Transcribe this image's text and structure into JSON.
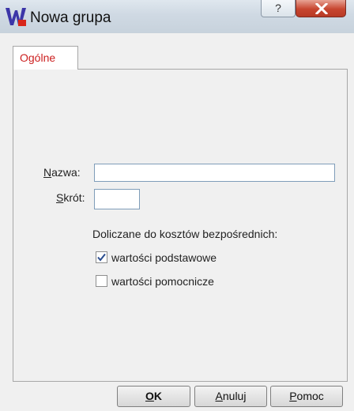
{
  "window": {
    "title": "Nowa grupa",
    "help_glyph": "?",
    "close_icon": "close-icon"
  },
  "tabs": [
    {
      "label": "Ogólne",
      "active": true,
      "color": "#cc2020"
    }
  ],
  "form": {
    "name_label_prefix": "N",
    "name_label_rest": "azwa:",
    "name_value": "",
    "short_label_prefix": "S",
    "short_label_rest": "krót:",
    "short_value": "",
    "costs_label": "Doliczane do kosztów bezpośrednich:",
    "options": [
      {
        "label": "wartości podstawowe",
        "checked": true
      },
      {
        "label": "wartości pomocnicze",
        "checked": false
      }
    ]
  },
  "buttons": {
    "ok_prefix": "O",
    "ok_rest": "K",
    "cancel_prefix": "A",
    "cancel_rest": "nuluj",
    "help_prefix": "P",
    "help_rest": "omoc"
  }
}
